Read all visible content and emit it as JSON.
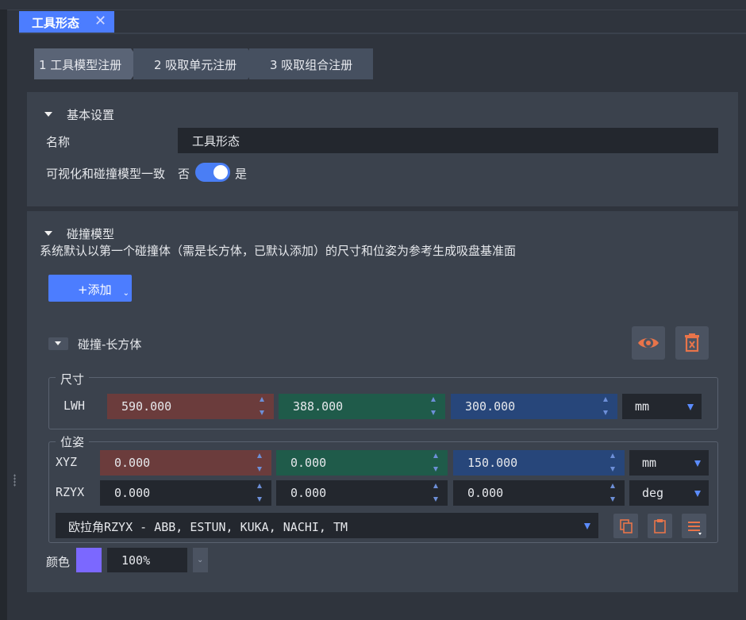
{
  "tab": {
    "title": "工具形态",
    "close_glyph": "✕"
  },
  "steps": [
    {
      "label": "1 工具模型注册"
    },
    {
      "label": "2 吸取单元注册"
    },
    {
      "label": "3 吸取组合注册"
    }
  ],
  "basic": {
    "title": "基本设置",
    "name_label": "名称",
    "name_value": "工具形态",
    "consistent_label": "可视化和碰撞模型一致",
    "toggle_off_label": "否",
    "toggle_on_label": "是",
    "toggle_state": "on"
  },
  "collision": {
    "title": "碰撞模型",
    "description": "系统默认以第一个碰撞体（需是长方体，已默认添加）的尺寸和位姿为参考生成吸盘基准面",
    "add_label": "+添加",
    "body_title": "碰撞-长方体",
    "size": {
      "legend": "尺寸",
      "row_label": "LWH",
      "values": [
        "590.000",
        "388.000",
        "300.000"
      ],
      "unit": "mm"
    },
    "pose": {
      "legend": "位姿",
      "xyz_label": "XYZ",
      "xyz_values": [
        "0.000",
        "0.000",
        "150.000"
      ],
      "xyz_unit": "mm",
      "rzyx_label": "RZYX",
      "rzyx_values": [
        "0.000",
        "0.000",
        "0.000"
      ],
      "rzyx_unit": "deg",
      "euler_convention": "欧拉角RZYX - ABB, ESTUN, KUKA, NACHI, TM"
    },
    "color": {
      "label": "颜色",
      "swatch": "#7b68ff",
      "opacity": "100%"
    }
  },
  "colors": {
    "accent": "#4c7dff",
    "danger_icon": "#e8744a",
    "x_field": "#6b3c3c",
    "y_field": "#1f5b4a",
    "z_field": "#27467a"
  }
}
